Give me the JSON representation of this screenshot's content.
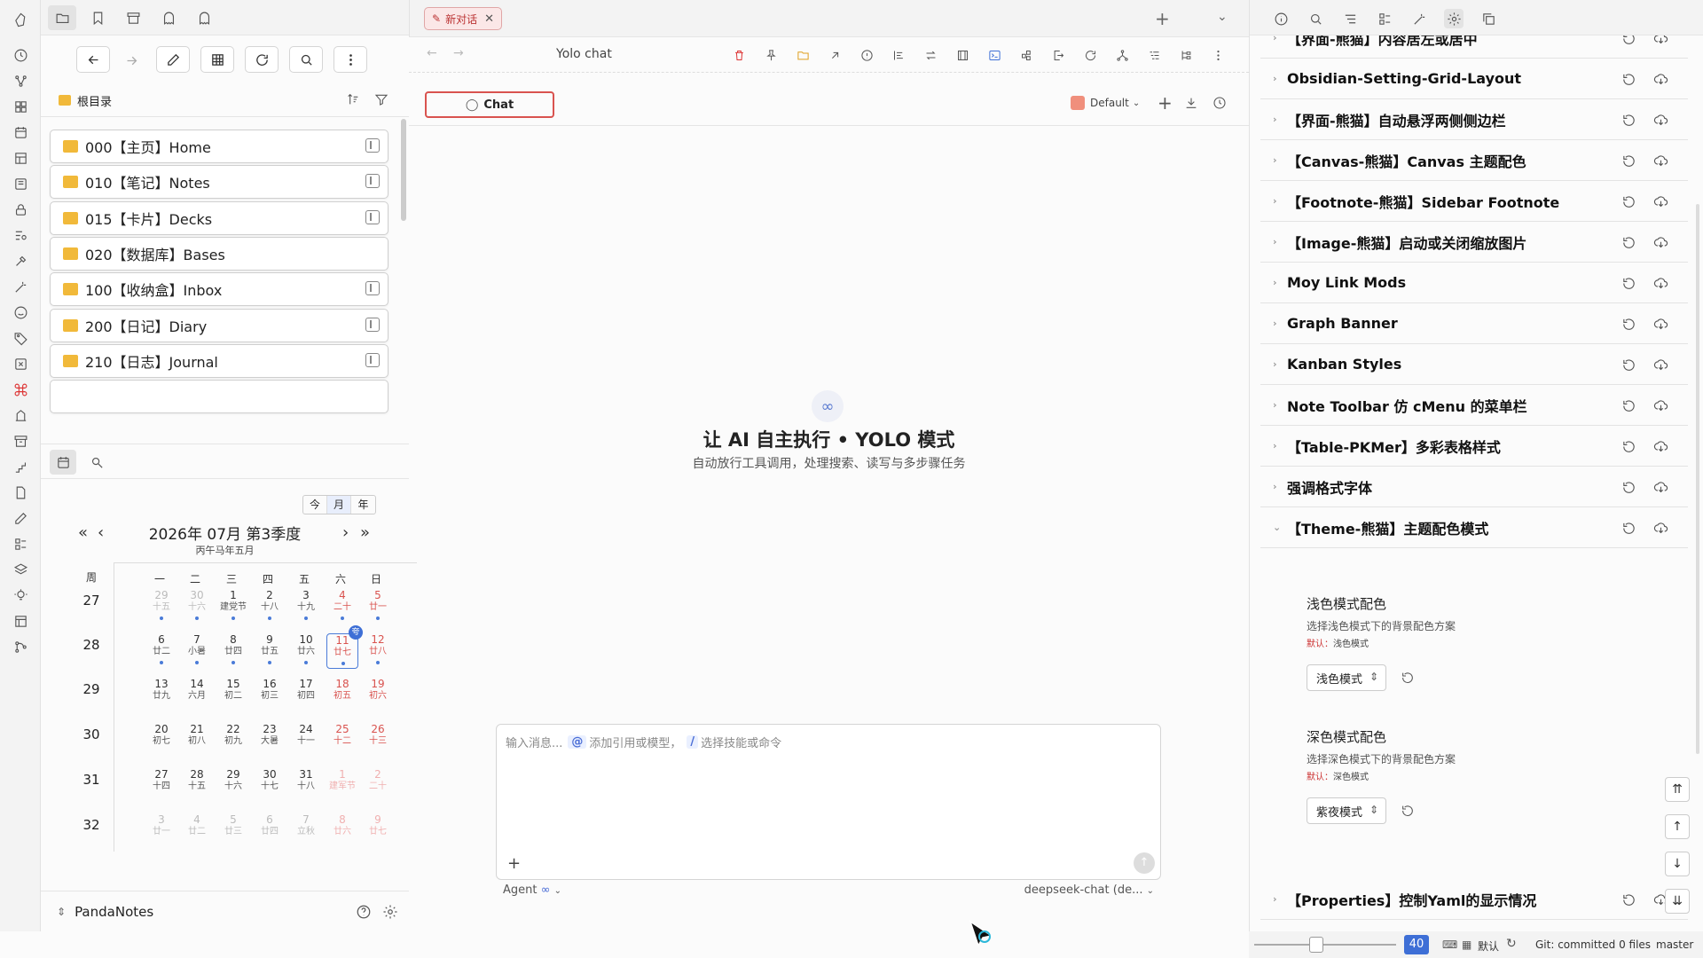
{
  "left_panel": {
    "root_label": "根目录",
    "folders": [
      "000【主页】Home",
      "010【笔记】Notes",
      "015【卡片】Decks",
      "020【数据库】Bases",
      "100【收纳盒】Inbox",
      "200【日记】Diary",
      "210【日志】Journal"
    ]
  },
  "calendar": {
    "mode_today": "今",
    "mode_month": "月",
    "mode_year": "年",
    "year_month": "2026年  07月  第3季度",
    "lunar_header": "丙午马年五月",
    "week_header": "周",
    "weekdays": [
      "一",
      "二",
      "三",
      "四",
      "五",
      "六",
      "日"
    ],
    "weeks": [
      "27",
      "28",
      "29",
      "30",
      "31",
      "32"
    ],
    "days": [
      [
        "29",
        "十五"
      ],
      [
        "30",
        "十六"
      ],
      [
        "1",
        "建党节"
      ],
      [
        "2",
        "十八"
      ],
      [
        "3",
        "十九"
      ],
      [
        "4",
        "二十"
      ],
      [
        "5",
        "廿一"
      ],
      [
        "6",
        "廿二"
      ],
      [
        "7",
        "小暑"
      ],
      [
        "8",
        "廿四"
      ],
      [
        "9",
        "廿五"
      ],
      [
        "10",
        "廿六"
      ],
      [
        "11",
        "廿七"
      ],
      [
        "12",
        "廿八"
      ],
      [
        "13",
        "廿九"
      ],
      [
        "14",
        "六月"
      ],
      [
        "15",
        "初二"
      ],
      [
        "16",
        "初三"
      ],
      [
        "17",
        "初四"
      ],
      [
        "18",
        "初五"
      ],
      [
        "19",
        "初六"
      ],
      [
        "20",
        "初七"
      ],
      [
        "21",
        "初八"
      ],
      [
        "22",
        "初九"
      ],
      [
        "23",
        "大暑"
      ],
      [
        "24",
        "十一"
      ],
      [
        "25",
        "十二"
      ],
      [
        "26",
        "十三"
      ],
      [
        "27",
        "十四"
      ],
      [
        "28",
        "十五"
      ],
      [
        "29",
        "十六"
      ],
      [
        "30",
        "十七"
      ],
      [
        "31",
        "十八"
      ],
      [
        "1",
        "建军节"
      ],
      [
        "2",
        "二十"
      ],
      [
        "3",
        "廿一"
      ],
      [
        "4",
        "廿二"
      ],
      [
        "5",
        "廿三"
      ],
      [
        "6",
        "廿四"
      ],
      [
        "7",
        "立秋"
      ],
      [
        "8",
        "廿六"
      ],
      [
        "9",
        "廿七"
      ]
    ],
    "today_badge": "夸"
  },
  "vault": {
    "name": "PandaNotes"
  },
  "center": {
    "tab_label": "新对话",
    "view_title": "Yolo chat",
    "chat_button": "Chat",
    "model_preset": "Default",
    "hero_title": "让 AI 自主执行 • YOLO 模式",
    "hero_subtitle": "自动放行工具调用，处理搜索、读写与多步骤任务",
    "input_placeholder": "输入消息...",
    "at_key": "@",
    "at_hint": "添加引用或模型，",
    "slash_key": "/",
    "slash_hint": "选择技能或命令",
    "agent_label": "Agent",
    "model_name": "deepseek-chat (de..."
  },
  "settings": {
    "rows": [
      "【界面-熊猫】内容居左或居中",
      "Obsidian-Setting-Grid-Layout",
      "【界面-熊猫】自动悬浮两侧侧边栏",
      "【Canvas-熊猫】Canvas 主题配色",
      "【Footnote-熊猫】Sidebar Footnote",
      "【Image-熊猫】启动或关闭缩放图片",
      "Moy Link Mods",
      "Graph Banner",
      "Kanban Styles",
      "Note Toolbar 仿 cMenu 的菜单栏",
      "【Table-PKMer】多彩表格样式",
      "强调格式字体",
      "【Theme-熊猫】主题配色模式"
    ],
    "light_title": "浅色模式配色",
    "light_desc": "选择浅色模式下的背景配色方案",
    "light_default_label": "默认：",
    "light_default_value": "浅色模式",
    "light_value": "浅色模式",
    "dark_title": "深色模式配色",
    "dark_desc": "选择深色模式下的背景配色方案",
    "dark_default_label": "默认：",
    "dark_default_value": "深色模式",
    "dark_value": "紫夜模式",
    "last_row": "【Properties】控制Yaml的显示情况"
  },
  "status": {
    "zoom": "40",
    "layout": "默认",
    "git": "Git: committed 0 files",
    "branch": "master"
  }
}
